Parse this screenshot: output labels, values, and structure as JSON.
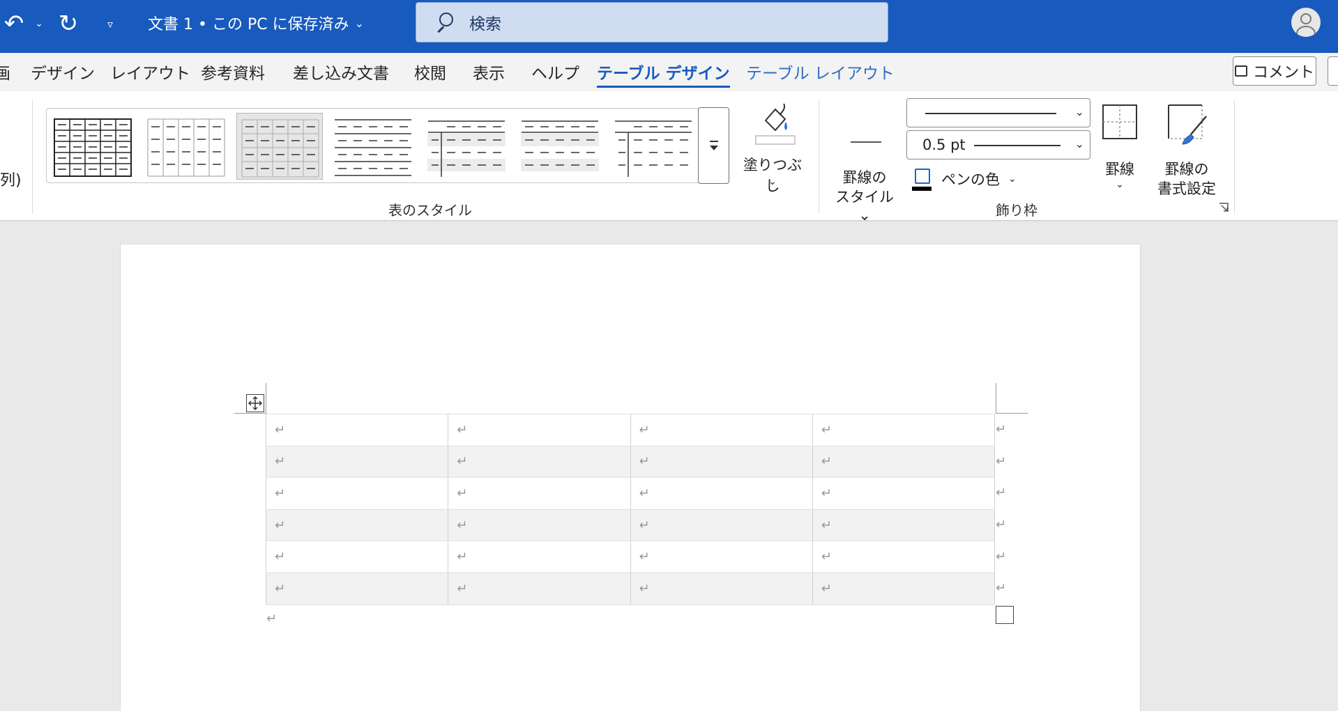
{
  "titlebar": {
    "doc_title": "文書 1 • この PC に保存済み",
    "search_placeholder": "検索"
  },
  "tabs": {
    "partial": "画",
    "items": [
      "デザイン",
      "レイアウト",
      "参考資料",
      "差し込み文書",
      "校閲",
      "表示",
      "ヘルプ"
    ],
    "active": "テーブル デザイン",
    "context": "テーブル レイアウト",
    "comment_label": "コメント"
  },
  "ribbon": {
    "left_fragment": "列)",
    "table_styles_label": "表のスタイル",
    "fill_label": "塗りつぶし",
    "line_style_label_1": "罫線の",
    "line_style_label_2": "スタイル",
    "weight_value": "0.5 pt",
    "pen_color_label": "ペンの色",
    "borders_label": "罫線",
    "painter_label_1": "罫線の",
    "painter_label_2": "書式設定",
    "borders_group_label": "飾り枠"
  },
  "document": {
    "rows": 6,
    "cols": 4,
    "cell_mark": "↵"
  },
  "colors": {
    "titlebar": "#185abd",
    "accent": "#185abd"
  }
}
